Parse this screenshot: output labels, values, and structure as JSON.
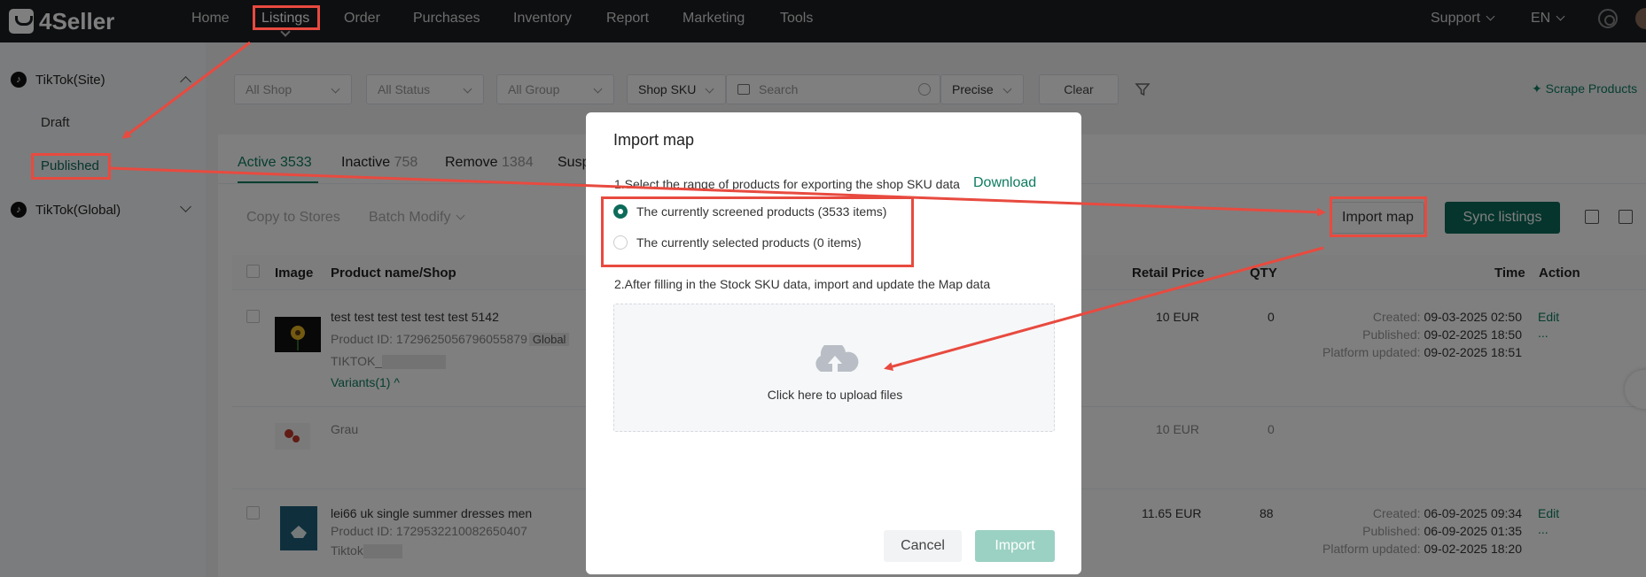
{
  "brand": "4Seller",
  "nav": {
    "items": [
      "Home",
      "Listings",
      "Order",
      "Purchases",
      "Inventory",
      "Report",
      "Marketing",
      "Tools"
    ],
    "support": "Support",
    "lang": "EN"
  },
  "sidebar": {
    "site_group": "TikTok(Site)",
    "draft": "Draft",
    "published": "Published",
    "global_group": "TikTok(Global)"
  },
  "filters": {
    "shop": "All Shop",
    "status": "All Status",
    "group": "All Group",
    "sku_type": "Shop SKU",
    "search_placeholder": "Search",
    "match": "Precise",
    "clear": "Clear",
    "scrape": "Scrape Products"
  },
  "tabs": [
    {
      "label": "Active",
      "count": "3533"
    },
    {
      "label": "Inactive",
      "count": "758"
    },
    {
      "label": "Remove",
      "count": "1384"
    },
    {
      "label": "Susp",
      "count": ""
    }
  ],
  "toolbar": {
    "copy": "Copy to Stores",
    "batch": "Batch Modify",
    "import_map": "Import map",
    "sync": "Sync listings"
  },
  "table": {
    "headers": {
      "image": "Image",
      "product": "Product name/Shop",
      "price": "Retail Price",
      "qty": "QTY",
      "time": "Time",
      "action": "Action"
    },
    "rows": [
      {
        "name": "test test test test test test 5142",
        "product_id": "Product ID: 1729625056796055879",
        "badge": "Global",
        "shop": "TIKTOK_",
        "variants": "Variants(1)",
        "price": "10 EUR",
        "qty": "0",
        "created_label": "Created:",
        "created": "09-03-2025 02:50",
        "published_label": "Published:",
        "published": "09-02-2025 18:50",
        "updated_label": "Platform updated:",
        "updated": "09-02-2025 18:51",
        "edit": "Edit",
        "more": "..."
      },
      {
        "name": "Grau",
        "price": "10 EUR",
        "qty": "0"
      },
      {
        "name": "lei66 uk single summer dresses men",
        "product_id": "Product ID: 1729532210082650407",
        "shop": "Tiktok",
        "price": "11.65 EUR",
        "qty": "88",
        "created_label": "Created:",
        "created": "06-09-2025 09:34",
        "published_label": "Published:",
        "published": "06-09-2025 01:35",
        "updated_label": "Platform updated:",
        "updated": "09-02-2025 18:20",
        "edit": "Edit",
        "more": "..."
      }
    ]
  },
  "modal": {
    "title": "Import map",
    "step1": "1.Select the range of products for exporting the shop SKU data",
    "download": "Download",
    "option1": "The currently screened products (3533 items)",
    "option2": "The currently selected products (0 items)",
    "step2": "2.After filling in the Stock SKU data, import and update the Map data",
    "upload": "Click here to upload files",
    "cancel": "Cancel",
    "import": "Import"
  },
  "colors": {
    "brand_green": "#0d6b5a",
    "annotation_red": "#e84a3f"
  }
}
